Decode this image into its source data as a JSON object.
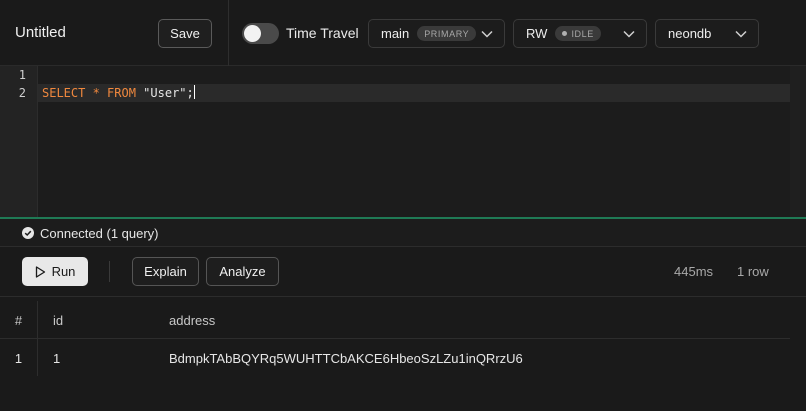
{
  "toolbar": {
    "title": "Untitled",
    "save_label": "Save",
    "time_travel_label": "Time Travel",
    "time_travel_enabled": false,
    "branch": {
      "value": "main",
      "badge": "PRIMARY"
    },
    "mode": {
      "value": "RW",
      "badge": "IDLE"
    },
    "database": {
      "value": "neondb"
    }
  },
  "editor": {
    "line_numbers": [
      "1",
      "2"
    ],
    "code_line_2": {
      "kw1": "SELECT",
      "star": " * ",
      "kw2": "FROM",
      "rest": " \"User\";"
    }
  },
  "status": {
    "text": "Connected (1 query)"
  },
  "actions": {
    "run_label": "Run",
    "explain_label": "Explain",
    "analyze_label": "Analyze",
    "duration": "445ms",
    "row_count": "1 row"
  },
  "results": {
    "columns": [
      "#",
      "id",
      "address"
    ],
    "rows": [
      {
        "num": "1",
        "id": "1",
        "address": "BdmpkTAbBQYRq5WUHTTCbAKCE6HbeoSzLZu1inQRrzU6"
      }
    ]
  },
  "colors": {
    "accent_green": "#1f7a55",
    "keyword": "#f0883e"
  }
}
